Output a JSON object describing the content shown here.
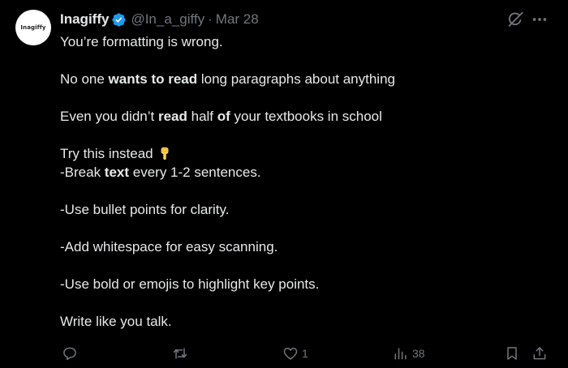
{
  "author": {
    "avatar_text": "Inagiffy",
    "name": "Inagiffy",
    "handle": "@In_a_giffy",
    "separator": "·",
    "date": "Mar 28"
  },
  "body": {
    "l1": "You’re formatting is wrong.",
    "l2_a": "No one ",
    "l2_b": "wants to read",
    "l2_c": " long paragraphs about anything",
    "l3_a": "Even you didn’t ",
    "l3_b": "read",
    "l3_c": " half ",
    "l3_d": "of",
    "l3_e": " your textbooks in school",
    "l4": "Try this instead",
    "l5_a": "-Break ",
    "l5_b": "text",
    "l5_c": " every 1-2 sentences.",
    "l6": "-Use bullet points for clarity.",
    "l7": "-Add whitespace for easy scanning.",
    "l8": "-Use bold or emojis to highlight key points.",
    "l9": "Write like you talk."
  },
  "actions": {
    "likes": "1",
    "views": "38"
  },
  "colors": {
    "background": "#000000",
    "text": "#e7e9ea",
    "muted": "#71767b",
    "verified": "#1d9bf0",
    "emoji": "#ffcc4d"
  }
}
